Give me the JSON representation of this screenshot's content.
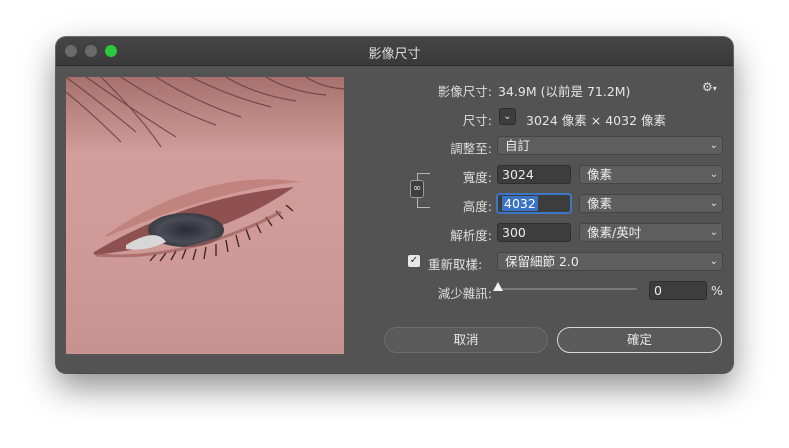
{
  "dialog": {
    "title": "影像尺寸"
  },
  "image_size": {
    "label": "影像尺寸:",
    "value": "34.9M (以前是 71.2M)"
  },
  "dimensions": {
    "label": "尺寸:",
    "value": "3024 像素 × 4032 像素"
  },
  "fit_to": {
    "label": "調整至:",
    "value": "自訂"
  },
  "width": {
    "label": "寬度:",
    "value": "3024",
    "unit": "像素"
  },
  "height": {
    "label": "高度:",
    "value": "4032",
    "unit": "像素"
  },
  "resolution": {
    "label": "解析度:",
    "value": "300",
    "unit": "像素/英吋"
  },
  "resample": {
    "label": "重新取樣:",
    "checked": true,
    "method": "保留細節 2.0"
  },
  "reduce_noise": {
    "label": "減少雜訊:",
    "value": "0",
    "unit": "%",
    "level": 0
  },
  "buttons": {
    "cancel": "取消",
    "ok": "確定"
  },
  "icons": {
    "settings": "gear-icon",
    "link": "chain-link-icon",
    "dropdown": "chevron-down-icon",
    "checkbox": "checkmark-icon"
  },
  "colors": {
    "accent": "#2bc840",
    "selection": "#3873c4",
    "panel": "#535353"
  }
}
